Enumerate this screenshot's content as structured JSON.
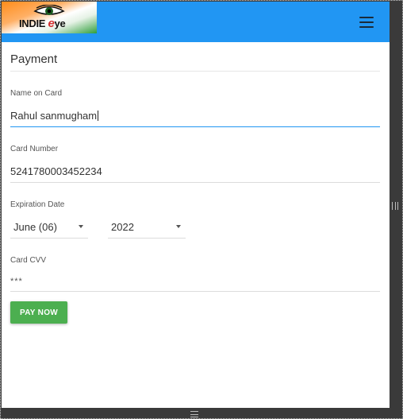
{
  "brand": {
    "logo_text_before": "INDIE ",
    "logo_text_accent": "e",
    "logo_text_after": "ye",
    "icon": "eye-icon",
    "accent_color": "#2196f3"
  },
  "navbar": {
    "menu_icon": "hamburger-menu-icon"
  },
  "payment": {
    "title": "Payment",
    "name_label": "Name on Card",
    "name_value": "Rahul sanmugham",
    "card_number_label": "Card Number",
    "card_number_value": "5241780003452234",
    "expiration_label": "Expiration Date",
    "expiration_month": "June (06)",
    "expiration_year": "2022",
    "cvv_label": "Card CVV",
    "cvv_value": "***",
    "pay_button_label": "PAY NOW",
    "pay_button_color": "#4caf50"
  }
}
